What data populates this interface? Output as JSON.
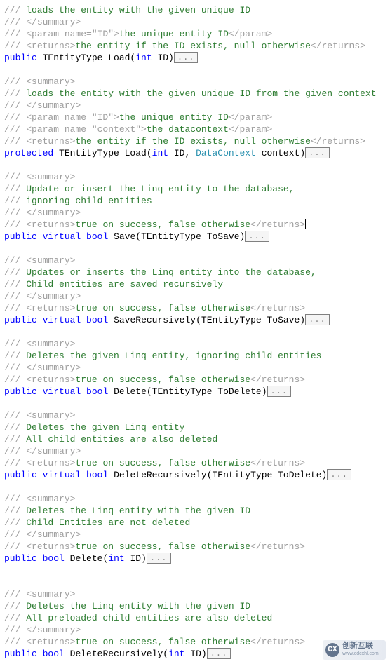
{
  "fold": "...",
  "cmt": {
    "p": "///"
  },
  "tag": {
    "sumO": "<summary>",
    "sumC": "</summary>",
    "parIdO": "<param name=\"ID\">",
    "parCtxO": "<param name=\"context\">",
    "parC": "</param>",
    "retO": "<returns>",
    "retC": "</returns>"
  },
  "kw": {
    "public": "public",
    "protected": "protected",
    "virtual": "virtual",
    "int": "int",
    "bool": "bool"
  },
  "ty": {
    "dc": "DataContext"
  },
  "wm": {
    "logo": "CX",
    "name": "创新互联",
    "url": "www.cdcxhl.com"
  },
  "b1": {
    "l1": " loads the entity with the given unique ID",
    "l2": "the unique entity ID",
    "l3": "the entity if the ID exists, null otherwise",
    "sig": " TEntityType Load(",
    "p1": " ID)"
  },
  "b2": {
    "l1": " loads the entity with the given unique ID from the given context",
    "l2": "the unique entity ID",
    "l3": "the datacontext",
    "l4": "the entity if the ID exists, null otherwise",
    "sig": " TEntityType Load(",
    "p1": " ID, ",
    "p2": " context)"
  },
  "b3": {
    "l1": " Update or insert the Linq entity to the database,",
    "l2": " ignoring child entities",
    "l3": "true on success, false otherwise",
    "sig": " Save(TEntityType ToSave)"
  },
  "b4": {
    "l1": " Updates or inserts the Linq entity into the database,",
    "l2": " Child entities are saved recursively",
    "l3": "true on success, false otherwise",
    "sig": " SaveRecursively(TEntityType ToSave)"
  },
  "b5": {
    "l1": "  Deletes the given Linq entity, ignoring child entities",
    "l2": "true on success, false otherwise",
    "sig": " Delete(TEntityType ToDelete)"
  },
  "b6": {
    "l1": "  Deletes the given Linq entity",
    "l2": "  All child entities are also deleted",
    "l3": "true on success, false otherwise",
    "sig": " DeleteRecursively(TEntityType ToDelete)"
  },
  "b7": {
    "l1": " Deletes the Linq entity with the given ID",
    "l2": " Child Entities are not deleted",
    "l3": "true on success, false otherwise",
    "sig": " Delete(",
    "p1": " ID)"
  },
  "b8": {
    "l1": " Deletes the Linq entity with the given ID",
    "l2": " All preloaded child entities are also deleted",
    "l3": "true on success, false otherwise",
    "sig": " DeleteRecursively(",
    "p1": " ID)"
  }
}
